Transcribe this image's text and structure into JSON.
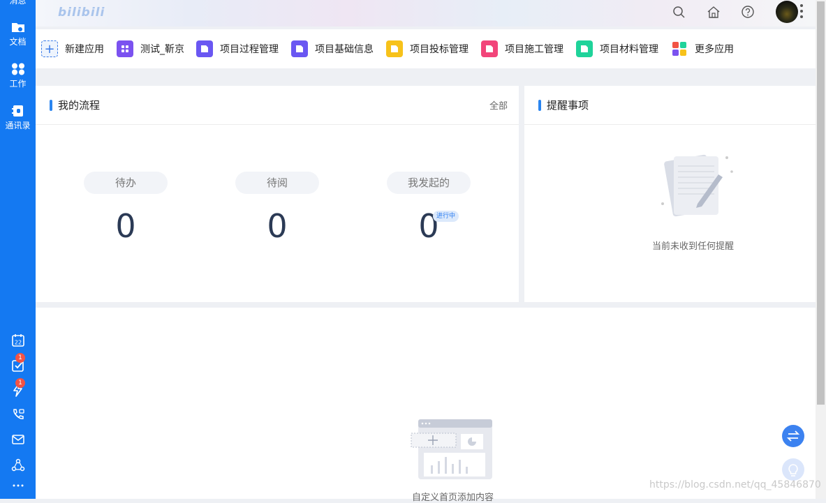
{
  "sidebar": {
    "top_partial_label": "消息",
    "items": [
      {
        "label": "文档",
        "icon": "folder-icon"
      },
      {
        "label": "工作",
        "icon": "grid-icon"
      },
      {
        "label": "通讯录",
        "icon": "contacts-icon"
      }
    ],
    "bottom_icons": [
      {
        "icon": "calendar-icon",
        "text": "22"
      },
      {
        "icon": "task-check-icon",
        "badge": "1"
      },
      {
        "icon": "lightning-icon",
        "badge": "1"
      },
      {
        "icon": "phone-video-icon"
      },
      {
        "icon": "mail-icon"
      },
      {
        "icon": "network-icon"
      },
      {
        "icon": "more-dots-icon"
      }
    ]
  },
  "topbar": {
    "logo": "bilibili",
    "icons": [
      "search-icon",
      "home-icon",
      "help-icon",
      "avatar",
      "kebab-menu-icon"
    ]
  },
  "apps": [
    {
      "label": "新建应用",
      "icon": "plus-icon",
      "color": "#3a7be8"
    },
    {
      "label": "测试_靳京",
      "icon": "grid-app-icon",
      "color": "#7b52f0"
    },
    {
      "label": "项目过程管理",
      "icon": "doc-app-icon",
      "color": "#6a57f2"
    },
    {
      "label": "项目基础信息",
      "icon": "doc-app-icon",
      "color": "#6a57f2"
    },
    {
      "label": "项目投标管理",
      "icon": "doc-app-icon",
      "color": "#f7c21a"
    },
    {
      "label": "项目施工管理",
      "icon": "doc-app-icon",
      "color": "#f2457a"
    },
    {
      "label": "项目材料管理",
      "icon": "doc-app-icon",
      "color": "#1fd39a"
    },
    {
      "label": "更多应用",
      "icon": "more-apps-icon",
      "color": "#f25345"
    }
  ],
  "flow_card": {
    "title": "我的流程",
    "more": "全部",
    "stats": [
      {
        "label": "待办",
        "value": "0"
      },
      {
        "label": "待阅",
        "value": "0"
      },
      {
        "label": "我发起的",
        "value": "0",
        "tag": "进行中"
      }
    ]
  },
  "remind_card": {
    "title": "提醒事项",
    "empty_text": "当前未收到任何提醒"
  },
  "custom_area": {
    "empty_text": "自定义首页添加内容"
  },
  "watermark": "https://blog.csdn.net/qq_45846870",
  "colors": {
    "sidebar": "#1479f2",
    "accent": "#2a85f0",
    "badge": "#f25345"
  }
}
